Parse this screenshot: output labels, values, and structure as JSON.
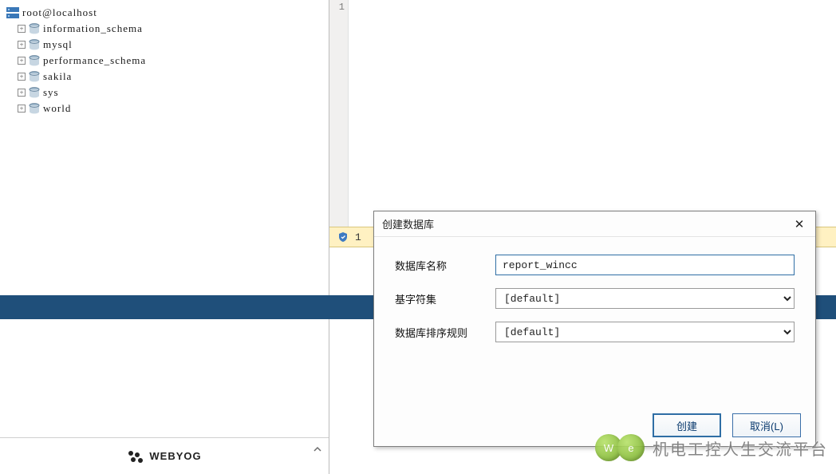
{
  "tree": {
    "root": "root@localhost",
    "items": [
      "information_schema",
      "mysql",
      "performance_schema",
      "sakila",
      "sys",
      "world"
    ]
  },
  "editor": {
    "gutter_line": "1"
  },
  "status": {
    "count": "1"
  },
  "footer": {
    "brand": "WEBYOG"
  },
  "dialog": {
    "title": "创建数据库",
    "fields": {
      "name_label": "数据库名称",
      "name_value": "report_wincc",
      "charset_label": "基字符集",
      "charset_value": "[default]",
      "collation_label": "数据库排序规则",
      "collation_value": "[default]"
    },
    "buttons": {
      "create": "创建",
      "cancel": "取消(L)"
    }
  },
  "watermark": {
    "bubble1": "W",
    "bubble2": "e",
    "text": "机电工控人生交流平台"
  }
}
